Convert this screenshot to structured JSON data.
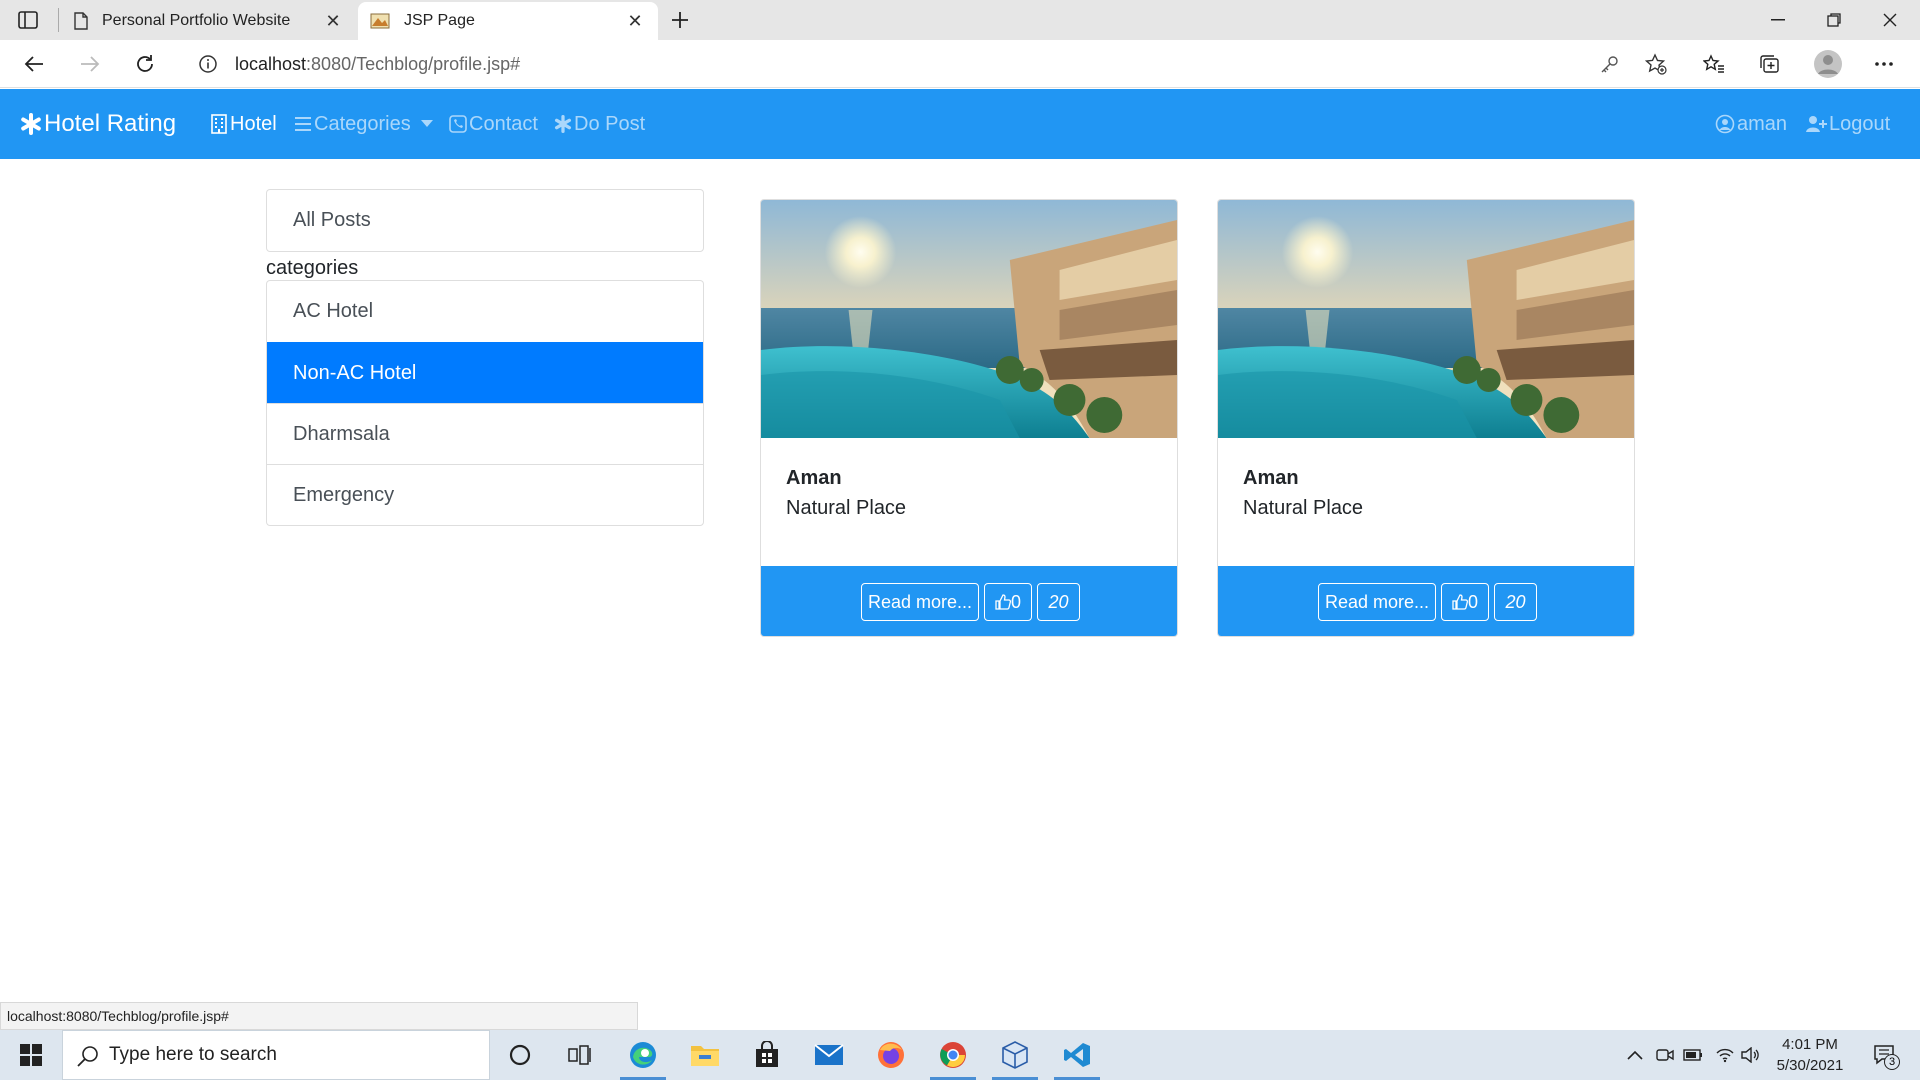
{
  "browser": {
    "tabs": [
      {
        "title": "Personal Portfolio Website",
        "active": false
      },
      {
        "title": "JSP Page",
        "active": true
      }
    ],
    "url_host": "localhost",
    "url_path": ":8080/Techblog/profile.jsp#",
    "status_url": "localhost:8080/Techblog/profile.jsp#"
  },
  "navbar": {
    "brand": "Hotel Rating",
    "items": [
      {
        "label": "Hotel",
        "icon": "building-icon"
      },
      {
        "label": "Categories",
        "icon": "list-icon"
      },
      {
        "label": "Contact",
        "icon": "phone-icon"
      },
      {
        "label": "Do Post",
        "icon": "asterisk-icon"
      }
    ],
    "user": "aman",
    "logout": "Logout",
    "color": "#2196f3"
  },
  "sidebar": {
    "all_posts": "All Posts",
    "heading": "categories",
    "categories": [
      "AC Hotel",
      "Non-AC Hotel",
      "Dharmsala",
      "Emergency"
    ],
    "active_category": "Non-AC Hotel",
    "active_color": "#007bff"
  },
  "posts": [
    {
      "title": "Aman",
      "text": "Natural Place",
      "read_more": "Read more...",
      "likes": "0",
      "comments": "20"
    },
    {
      "title": "Aman",
      "text": "Natural Place",
      "read_more": "Read more...",
      "likes": "0",
      "comments": "20"
    }
  ],
  "taskbar": {
    "search_placeholder": "Type here to search",
    "time": "4:01 PM",
    "date": "5/30/2021",
    "notifications": "3"
  }
}
